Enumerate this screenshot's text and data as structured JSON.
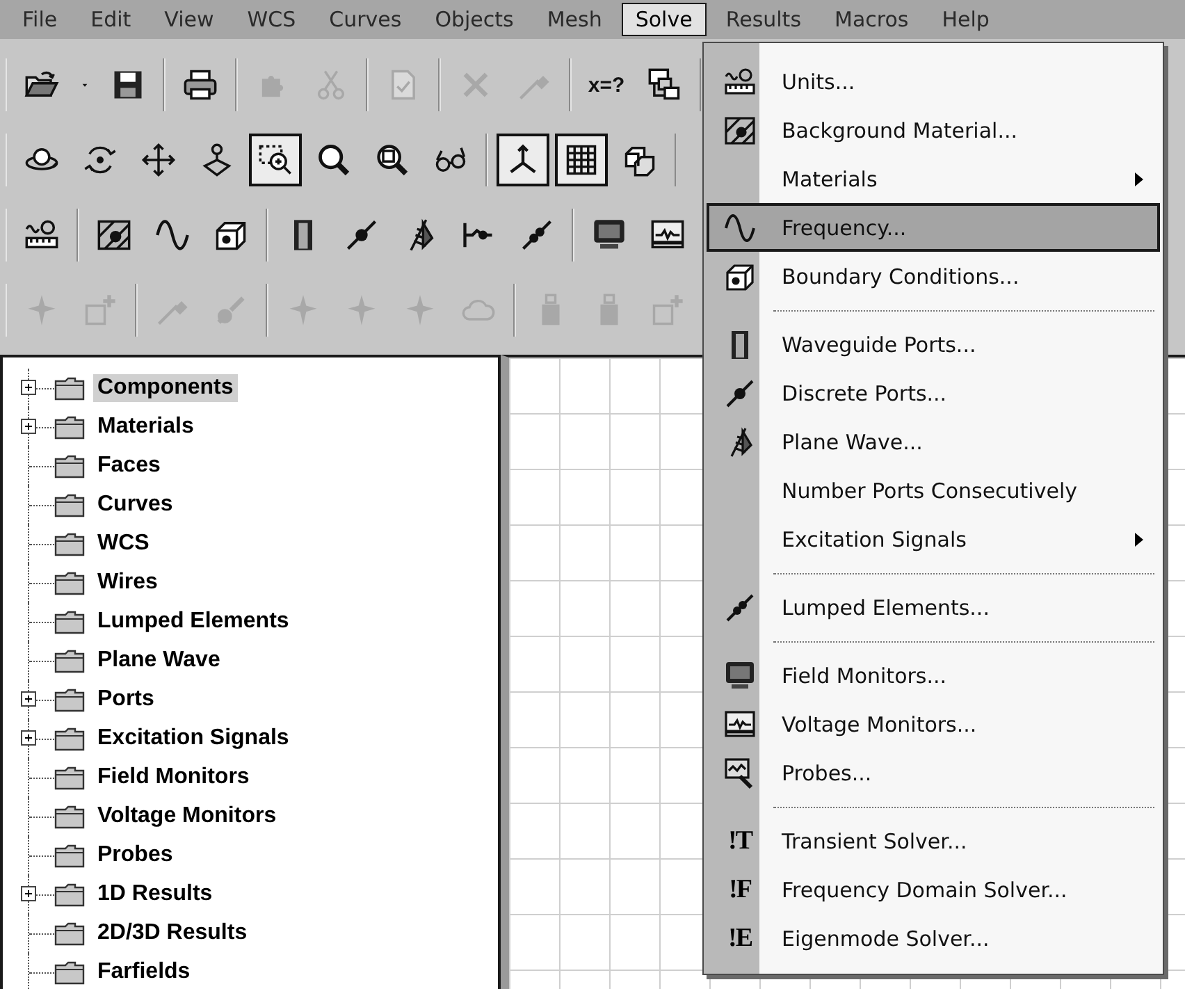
{
  "menu_bar": [
    {
      "label": "File",
      "selected": false
    },
    {
      "label": "Edit",
      "selected": false
    },
    {
      "label": "View",
      "selected": false
    },
    {
      "label": "WCS",
      "selected": false
    },
    {
      "label": "Curves",
      "selected": false
    },
    {
      "label": "Objects",
      "selected": false
    },
    {
      "label": "Mesh",
      "selected": false
    },
    {
      "label": "Solve",
      "selected": true
    },
    {
      "label": "Results",
      "selected": false
    },
    {
      "label": "Macros",
      "selected": false
    },
    {
      "label": "Help",
      "selected": false
    }
  ],
  "toolbars": [
    {
      "groups": [
        {
          "buttons": [
            {
              "kind": "open-folder",
              "pressed": false,
              "disabled": false
            },
            {
              "kind": "caret",
              "pressed": false,
              "disabled": false
            },
            {
              "kind": "floppy",
              "pressed": false,
              "disabled": false
            }
          ]
        },
        {
          "buttons": [
            {
              "kind": "printer",
              "pressed": false,
              "disabled": false
            }
          ]
        },
        {
          "buttons": [
            {
              "kind": "puzzle",
              "pressed": false,
              "disabled": true
            },
            {
              "kind": "scissors",
              "pressed": false,
              "disabled": true
            }
          ]
        },
        {
          "buttons": [
            {
              "kind": "document",
              "pressed": false,
              "disabled": true
            }
          ]
        },
        {
          "buttons": [
            {
              "kind": "cross",
              "pressed": false,
              "disabled": true
            },
            {
              "kind": "pencil",
              "pressed": false,
              "disabled": true
            }
          ]
        },
        {
          "buttons": [
            {
              "kind": "text",
              "label": "x=?",
              "pressed": false,
              "disabled": false
            },
            {
              "kind": "tree-window",
              "pressed": false,
              "disabled": false
            }
          ]
        }
      ]
    },
    {
      "groups": [
        {
          "buttons": [
            {
              "kind": "orbit",
              "pressed": false,
              "disabled": false
            },
            {
              "kind": "rotate",
              "pressed": false,
              "disabled": false
            },
            {
              "kind": "pan",
              "pressed": false,
              "disabled": false
            },
            {
              "kind": "walk",
              "pressed": false,
              "disabled": false
            },
            {
              "kind": "zoom-rect",
              "pressed": true,
              "disabled": false
            },
            {
              "kind": "magnifier",
              "pressed": false,
              "disabled": false
            },
            {
              "kind": "zoom-fit",
              "pressed": false,
              "disabled": false
            },
            {
              "kind": "glasses",
              "pressed": false,
              "disabled": false
            }
          ]
        },
        {
          "buttons": [
            {
              "kind": "axes",
              "pressed": true,
              "disabled": false
            },
            {
              "kind": "grid",
              "pressed": true,
              "disabled": false
            },
            {
              "kind": "cubes",
              "pressed": false,
              "disabled": false
            }
          ]
        }
      ]
    },
    {
      "groups": [
        {
          "buttons": [
            {
              "kind": "units",
              "pressed": false,
              "disabled": false
            }
          ]
        },
        {
          "buttons": [
            {
              "kind": "bg-material",
              "pressed": false,
              "disabled": false
            },
            {
              "kind": "sine",
              "pressed": false,
              "disabled": false
            },
            {
              "kind": "boundary-cube",
              "pressed": false,
              "disabled": false
            }
          ]
        },
        {
          "buttons": [
            {
              "kind": "door",
              "pressed": false,
              "disabled": false
            },
            {
              "kind": "discrete-port",
              "pressed": false,
              "disabled": false
            },
            {
              "kind": "plane-wave",
              "pressed": false,
              "disabled": false
            },
            {
              "kind": "line-marker",
              "pressed": false,
              "disabled": false
            },
            {
              "kind": "lumped",
              "pressed": false,
              "disabled": false
            }
          ]
        },
        {
          "buttons": [
            {
              "kind": "monitor",
              "pressed": false,
              "disabled": false
            },
            {
              "kind": "voltage-monitor",
              "pressed": false,
              "disabled": false
            }
          ]
        }
      ]
    },
    {
      "groups": [
        {
          "buttons": [
            {
              "kind": "sparkle",
              "pressed": false,
              "disabled": true
            },
            {
              "kind": "add-box",
              "pressed": false,
              "disabled": true
            }
          ]
        },
        {
          "buttons": [
            {
              "kind": "pencil",
              "pressed": false,
              "disabled": true
            },
            {
              "kind": "brush",
              "pressed": false,
              "disabled": true
            }
          ]
        },
        {
          "buttons": [
            {
              "kind": "sparkle",
              "pressed": false,
              "disabled": true
            },
            {
              "kind": "sparkle",
              "pressed": false,
              "disabled": true
            },
            {
              "kind": "sparkle",
              "pressed": false,
              "disabled": true
            },
            {
              "kind": "cloud",
              "pressed": false,
              "disabled": true
            }
          ]
        },
        {
          "buttons": [
            {
              "kind": "bottle",
              "pressed": false,
              "disabled": true
            },
            {
              "kind": "bottle",
              "pressed": false,
              "disabled": true
            },
            {
              "kind": "add-box",
              "pressed": false,
              "disabled": true
            }
          ]
        }
      ]
    }
  ],
  "tree": {
    "items": [
      {
        "label": "Components",
        "expandable": true,
        "selected": true
      },
      {
        "label": "Materials",
        "expandable": true,
        "selected": false
      },
      {
        "label": "Faces",
        "expandable": false,
        "selected": false
      },
      {
        "label": "Curves",
        "expandable": false,
        "selected": false
      },
      {
        "label": "WCS",
        "expandable": false,
        "selected": false
      },
      {
        "label": "Wires",
        "expandable": false,
        "selected": false
      },
      {
        "label": "Lumped Elements",
        "expandable": false,
        "selected": false
      },
      {
        "label": "Plane Wave",
        "expandable": false,
        "selected": false
      },
      {
        "label": "Ports",
        "expandable": true,
        "selected": false
      },
      {
        "label": "Excitation Signals",
        "expandable": true,
        "selected": false
      },
      {
        "label": "Field Monitors",
        "expandable": false,
        "selected": false
      },
      {
        "label": "Voltage Monitors",
        "expandable": false,
        "selected": false
      },
      {
        "label": "Probes",
        "expandable": false,
        "selected": false
      },
      {
        "label": "1D Results",
        "expandable": true,
        "selected": false
      },
      {
        "label": "2D/3D Results",
        "expandable": false,
        "selected": false
      },
      {
        "label": "Farfields",
        "expandable": false,
        "selected": false
      }
    ]
  },
  "solve_menu": {
    "items": [
      {
        "kind": "units",
        "label": "Units...",
        "submenu": false,
        "selected": false
      },
      {
        "kind": "bg-material",
        "label": "Background Material...",
        "submenu": false,
        "selected": false
      },
      {
        "kind": "plain",
        "label": "Materials",
        "submenu": true,
        "selected": false
      },
      {
        "kind": "sine",
        "label": "Frequency...",
        "submenu": false,
        "selected": true
      },
      {
        "kind": "boundary-cube",
        "label": "Boundary Conditions...",
        "submenu": false,
        "selected": false
      },
      {
        "kind": "separator"
      },
      {
        "kind": "door",
        "label": "Waveguide Ports...",
        "submenu": false,
        "selected": false
      },
      {
        "kind": "discrete-port",
        "label": "Discrete Ports...",
        "submenu": false,
        "selected": false
      },
      {
        "kind": "plane-wave",
        "label": "Plane Wave...",
        "submenu": false,
        "selected": false
      },
      {
        "kind": "plain",
        "label": "Number Ports Consecutively",
        "submenu": false,
        "selected": false
      },
      {
        "kind": "plain",
        "label": "Excitation Signals",
        "submenu": true,
        "selected": false
      },
      {
        "kind": "separator"
      },
      {
        "kind": "lumped",
        "label": "Lumped Elements...",
        "submenu": false,
        "selected": false
      },
      {
        "kind": "separator"
      },
      {
        "kind": "monitor",
        "label": "Field Monitors...",
        "submenu": false,
        "selected": false
      },
      {
        "kind": "voltage-monitor",
        "label": "Voltage Monitors...",
        "submenu": false,
        "selected": false
      },
      {
        "kind": "probe",
        "label": "Probes...",
        "submenu": false,
        "selected": false
      },
      {
        "kind": "separator"
      },
      {
        "kind": "solver",
        "icon_text": "!T",
        "label": "Transient Solver...",
        "submenu": false,
        "selected": false
      },
      {
        "kind": "solver",
        "icon_text": "!F",
        "label": "Frequency Domain Solver...",
        "submenu": false,
        "selected": false
      },
      {
        "kind": "solver",
        "icon_text": "!E",
        "label": "Eigenmode Solver...",
        "submenu": false,
        "selected": false
      }
    ]
  }
}
